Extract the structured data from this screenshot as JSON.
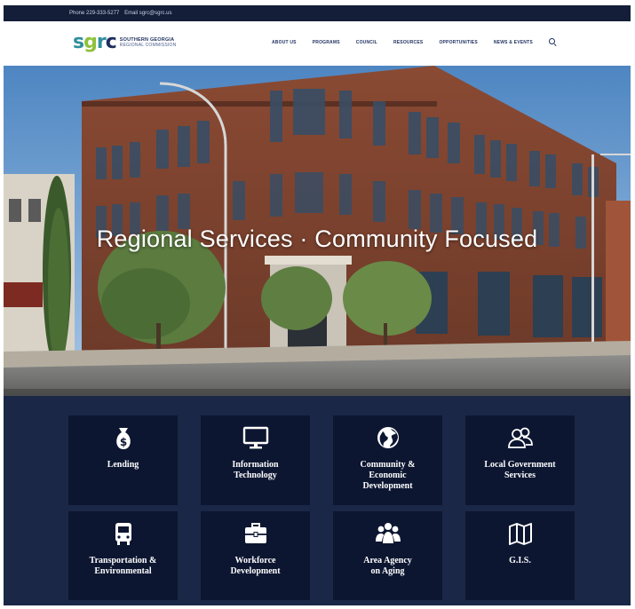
{
  "topbar": {
    "phone": "Phone 229-333-5277",
    "email": "Email sgrc@sgrc.us"
  },
  "logo": {
    "mark_s": "s",
    "mark_g": "g",
    "mark_r": "r",
    "mark_c": "c",
    "line1": "SOUTHERN GEORGIA",
    "line2": "REGIONAL COMMISSION"
  },
  "nav": {
    "items": [
      "ABOUT US",
      "PROGRAMS",
      "COUNCIL",
      "RESOURCES",
      "OPPORTUNITIES",
      "NEWS & EVENTS"
    ],
    "search_icon": "search-icon"
  },
  "hero": {
    "title": "Regional Services · Community Focused"
  },
  "services": [
    {
      "label": "Lending",
      "icon": "money-bag-icon"
    },
    {
      "label": "Information\nTechnology",
      "icon": "monitor-icon"
    },
    {
      "label": "Community &\nEconomic\nDevelopment",
      "icon": "globe-icon"
    },
    {
      "label": "Local Government\nServices",
      "icon": "people-icon"
    },
    {
      "label": "Transportation &\nEnvironmental",
      "icon": "bus-icon"
    },
    {
      "label": "Workforce\nDevelopment",
      "icon": "briefcase-icon"
    },
    {
      "label": "Area Agency\non Aging",
      "icon": "group-icon"
    },
    {
      "label": "G.I.S.",
      "icon": "map-icon"
    }
  ],
  "colors": {
    "navy": "#1a2747",
    "card": "#0d1631",
    "teal": "#2e8f9c",
    "green": "#8fc13c"
  }
}
